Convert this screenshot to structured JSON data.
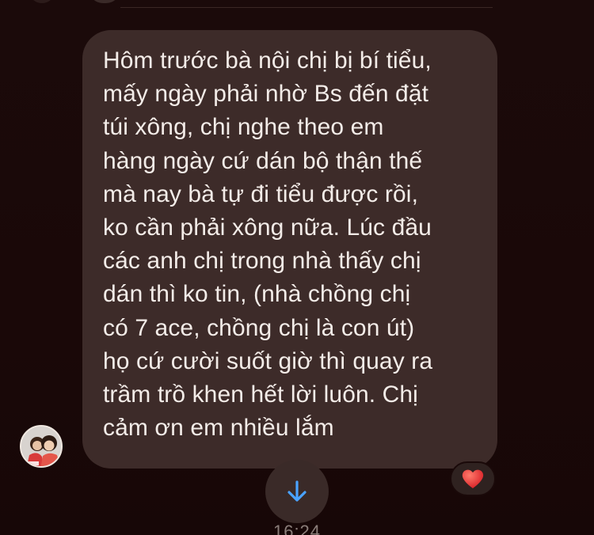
{
  "conversation": {
    "message": {
      "text": "Hôm trước bà nội chị bị bí tiểu,\nmấy ngày phải nhờ Bs đến đặt\ntúi xông, chị nghe theo em\nhàng ngày cứ dán bộ thận thế\nmà nay bà tự đi tiểu được rồi,\nko cần phải xông nữa. Lúc đầu\ncác anh chị trong nhà thấy chị\ndán thì ko tin, (nhà chồng chị\ncó 7 ace, chồng chị là con út)\nhọ cứ cười suốt giờ thì quay ra\ntrầm trồ khen hết lời luôn. Chị\ncảm ơn em nhiều lắm",
      "reaction_icon": "heart-icon",
      "reaction_color": "#e8322f"
    },
    "sender_avatar_icon": "avatar",
    "scroll_down_icon": "arrow-down-icon",
    "timestamp": "16:24"
  },
  "colors": {
    "background": "#1a0909",
    "bubble": "#3d2b29",
    "text": "#f3ece8",
    "accent_arrow": "#4aa3ff"
  }
}
